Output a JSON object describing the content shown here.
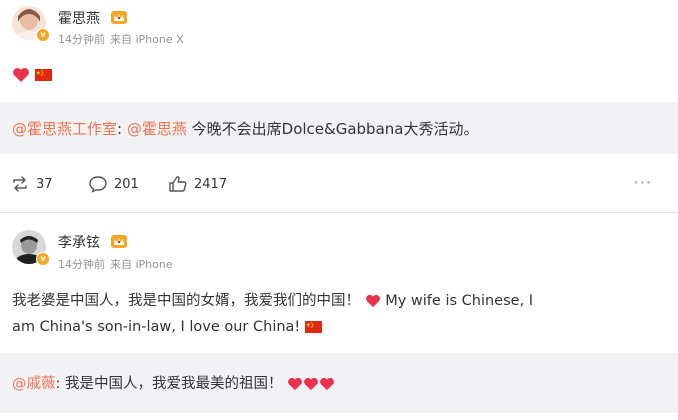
{
  "post1": {
    "author": "霍思燕",
    "time": "14分钟前",
    "source": "来自 iPhone X",
    "content_icons": [
      "heart-icon",
      "china-flag-icon"
    ],
    "repost": {
      "mention1": "@霍思燕工作室",
      "sep": ":",
      "mention2": "@霍思燕",
      "text": "今晚不会出席Dolce&Gabbana大秀活动。"
    },
    "actions": {
      "repost_count": "37",
      "comment_count": "201",
      "like_count": "2417",
      "more": "···"
    }
  },
  "post2": {
    "author": "李承铉",
    "time": "14分钟前",
    "source": "来自 iPhone",
    "line1": "我老婆是中国人，我是中国的女婿，我爱我们的中国！",
    "line1_en": "My wife is Chinese, I",
    "line2": "am China's son-in-law, I love our China!",
    "repost": {
      "mention": "@戚薇",
      "text": ": 我是中国人，我爱我最美的祖国！"
    }
  },
  "colors": {
    "accent_link": "#eb7350",
    "verified_badge": "#f5a623",
    "meta_gray": "#939393",
    "repost_bg": "#f2f2f5",
    "heart_red": "#e8334a",
    "flag_red": "#de2910"
  }
}
